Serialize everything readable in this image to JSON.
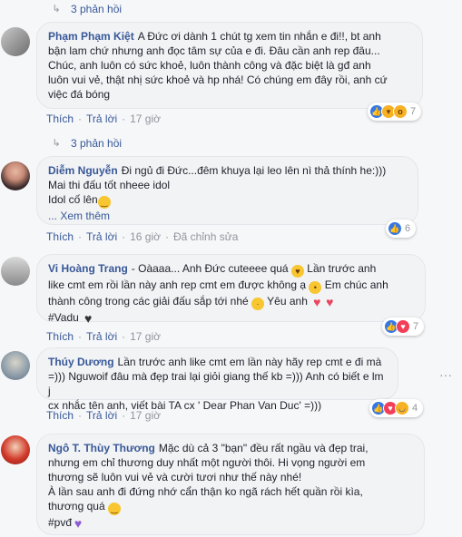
{
  "replies_toggle_1": "3 phản hồi",
  "replies_toggle_2": "3 phản hồi",
  "comments": [
    {
      "name": "Phạm Phạm Kiệt",
      "lines": [
        "A Đức ơi dành 1 chút tg xem tin nhắn e đi!!, bt anh",
        "bận lam chứ nhưng anh đọc tâm sự của e đi. Đâu cần anh rep đâu...",
        "Chúc, anh luôn có sức khoẻ, luôn thành công và đặc biệt là gđ anh",
        "luôn vui vẻ, thật nhị sức khoẻ và hp nhá! Có chúng em đây rồi, anh cứ",
        "việc đá bóng"
      ],
      "reaction_count": "7",
      "action_like": "Thích",
      "action_reply": "Trả lời",
      "time": "17 giờ"
    },
    {
      "name": "Diễm Nguyễn",
      "lines": [
        "Đi ngủ đi Đức...đêm khuya lại leo lên nì thả thính he:)))",
        "Mai thi đấu tốt nheee idol",
        "Idol cố lên",
        "... Xem thêm"
      ],
      "reaction_count": "6",
      "action_like": "Thích",
      "action_reply": "Trả lời",
      "time": "16 giờ",
      "edited": "Đã chỉnh sửa"
    },
    {
      "name": "Vi Hoàng Trang",
      "lines": [
        "- Oàaaa... Anh Đức cuteeee quá",
        "Lần trước anh",
        "like cmt em rồi lần này anh rep cmt em được không ạ",
        "Em chúc anh",
        "thành công trong các giải đấu sắp tới nhé",
        "Yêu anh",
        "#Vadu"
      ],
      "reaction_count": "7",
      "action_like": "Thích",
      "action_reply": "Trả lời",
      "time": "17 giờ"
    },
    {
      "name": "Thúy Dương",
      "lines": [
        "Lần trước anh like cmt em lần này hãy rep cmt e đi mà",
        "=))) Nguwoif đâu mà đẹp trai lại giỏi giang thế kb =))) Anh có biết e lm j",
        "cx nhắc tên anh, viết bài TA cx ' Dear Phan Van Duc' =)))"
      ],
      "reaction_count": "4",
      "action_like": "Thích",
      "action_reply": "Trả lời",
      "time": "17 giờ"
    },
    {
      "name": "Ngô T. Thùy Thương",
      "lines": [
        "Mặc dù cả 3 \"bạn\" đều rất ngầu và đẹp trai,",
        "nhưng em chỉ thương duy nhất một người thôi. Hi vọng người em",
        "thương sẽ luôn vui vẻ và cười tươi như thế này nhé!",
        "À lần sau anh đi đứng nhớ cẩn thận ko ngã rách hết quần rồi kìa,",
        "thương quá",
        "#pvđ"
      ]
    }
  ],
  "colors": {
    "link": "#385898",
    "meta": "#90949c",
    "bubble": "#f2f3f5",
    "like": "#3578e5",
    "love": "#f33e58"
  }
}
